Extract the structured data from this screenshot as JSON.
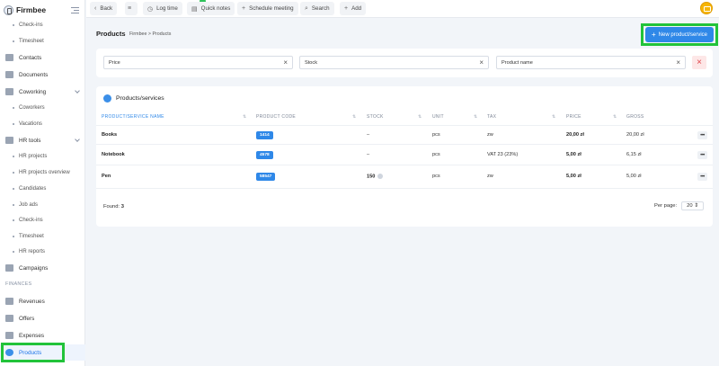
{
  "brand": {
    "name": "Firmbee"
  },
  "sidebar": {
    "items": [
      {
        "label": "Check-ins",
        "sub": true
      },
      {
        "label": "Timesheet",
        "sub": true
      },
      {
        "label": "Contacts"
      },
      {
        "label": "Documents"
      },
      {
        "label": "Coworking",
        "expandable": true
      },
      {
        "label": "Coworkers",
        "sub": true
      },
      {
        "label": "Vacations",
        "sub": true
      },
      {
        "label": "HR tools",
        "expandable": true
      },
      {
        "label": "HR projects",
        "sub": true
      },
      {
        "label": "HR projects overview",
        "sub": true
      },
      {
        "label": "Candidates",
        "sub": true
      },
      {
        "label": "Job ads",
        "sub": true
      },
      {
        "label": "Check-ins",
        "sub": true
      },
      {
        "label": "Timesheet",
        "sub": true
      },
      {
        "label": "HR reports",
        "sub": true
      },
      {
        "label": "Campaigns"
      },
      {
        "label": "Revenues"
      },
      {
        "label": "Offers"
      },
      {
        "label": "Expenses"
      },
      {
        "label": "Products",
        "active": true
      }
    ],
    "section_finances": "FINANCES"
  },
  "topbar": {
    "back": "Back",
    "log_time": "Log time",
    "quick_notes": "Quick notes",
    "schedule_meeting": "Schedule meeting",
    "search": "Search",
    "add": "Add"
  },
  "header": {
    "title": "Products",
    "breadcrumb": "Firmbee  >  Products",
    "new_button": "New product/service"
  },
  "filters": {
    "price": "Price",
    "stock": "Stock",
    "product_name": "Product name"
  },
  "table": {
    "title": "Products/services",
    "columns": [
      "PRODUCT/SERVICE NAME",
      "PRODUCT CODE",
      "STOCK",
      "UNIT",
      "TAX",
      "PRICE",
      "GROSS"
    ],
    "rows": [
      {
        "name": "Books",
        "code": "1414",
        "stock": "–",
        "unit": "pcs",
        "tax": "zw",
        "price": "20,00 zł",
        "gross": "20,00 zł"
      },
      {
        "name": "Notebook",
        "code": "4578",
        "stock": "–",
        "unit": "pcs",
        "tax": "VAT 23 (23%)",
        "price": "5,00 zł",
        "gross": "6,15 zł"
      },
      {
        "name": "Pen",
        "code": "58547",
        "stock": "150",
        "unit": "pcs",
        "tax": "zw",
        "price": "5,00 zł",
        "gross": "5,00 zł"
      }
    ],
    "found_label": "Found:",
    "found_count": "3",
    "per_page_label": "Per page:",
    "per_page_value": "20"
  },
  "colors": {
    "accent": "#2f88e8",
    "highlight": "#22c33a",
    "danger": "#e0454b"
  }
}
